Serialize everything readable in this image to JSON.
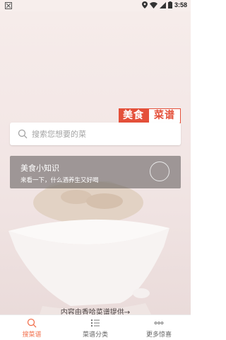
{
  "statusbar": {
    "time": "3:58"
  },
  "logo": {
    "part1": "美食",
    "part2": "菜谱"
  },
  "search": {
    "placeholder": "搜索您想要的菜"
  },
  "tip": {
    "title": "美食小知识",
    "subtitle": "来看一下，什么酒养生又好喝"
  },
  "credit": "内容由香哈菜谱提供→",
  "tabs": [
    {
      "label": "搜菜谱",
      "icon": "search-icon",
      "active": true
    },
    {
      "label": "菜谱分类",
      "icon": "list-icon",
      "active": false
    },
    {
      "label": "更多惊喜",
      "icon": "more-dots-icon",
      "active": false
    }
  ],
  "colors": {
    "accent": "#f2714e",
    "logo_red": "#e4503a"
  }
}
